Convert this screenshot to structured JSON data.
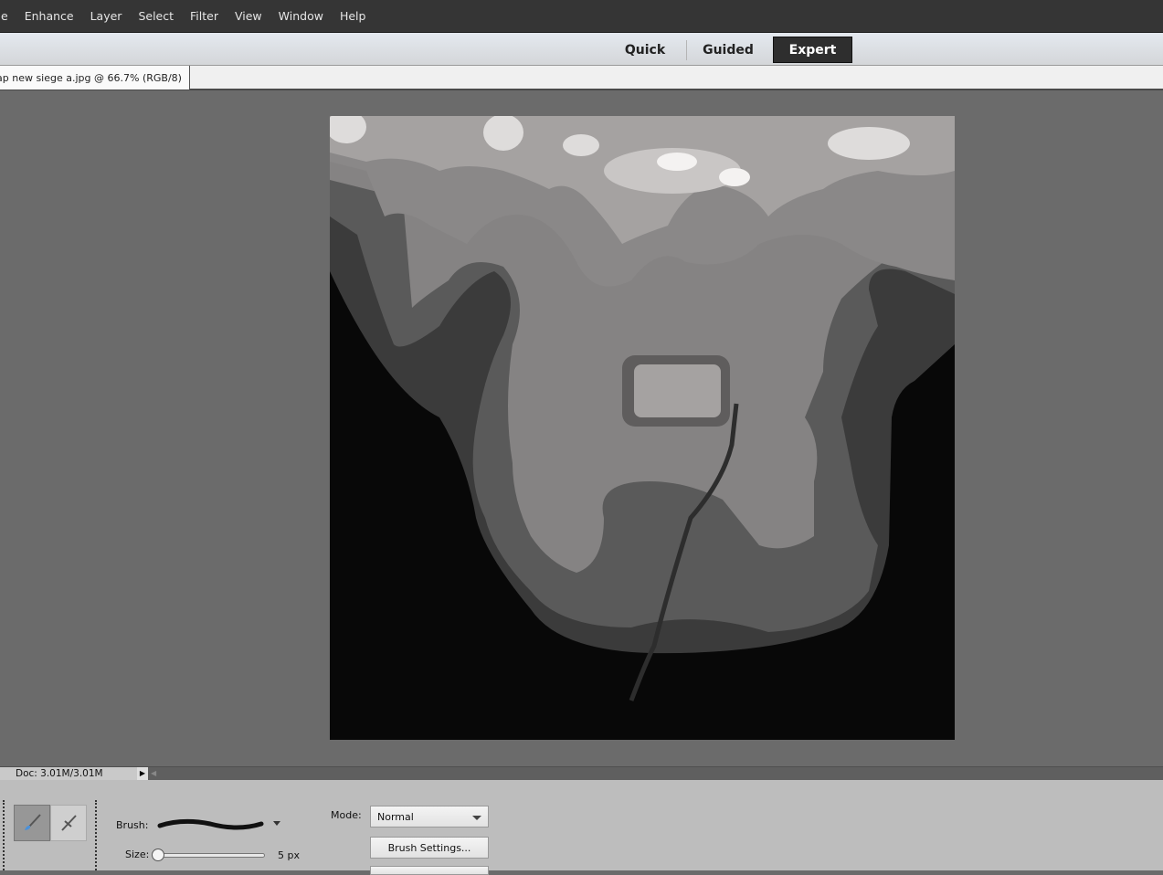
{
  "menubar": {
    "items": [
      "e",
      "Enhance",
      "Layer",
      "Select",
      "Filter",
      "View",
      "Window",
      "Help"
    ]
  },
  "modes": {
    "quick": "Quick",
    "guided": "Guided",
    "expert": "Expert",
    "active": "Expert"
  },
  "document_tab": {
    "title": "ap new siege a.jpg @ 66.7% (RGB/8)",
    "close": "×"
  },
  "status": {
    "doc_info": "Doc: 3.01M/3.01M",
    "arrow": "▶",
    "scroll_left": "◀"
  },
  "options": {
    "tools": [
      {
        "icon": "brush-icon",
        "active": true
      },
      {
        "icon": "impressionist-brush-icon",
        "active": false
      }
    ],
    "brush_label": "Brush:",
    "size_label": "Size:",
    "size_value": "5 px",
    "size_fraction": 0.0,
    "mode_label": "Mode:",
    "mode_value": "Normal",
    "brush_settings": "Brush Settings..."
  },
  "colors": {
    "menubar": "#353535",
    "workspace": "#6b6b6b",
    "options_panel": "#bdbdbd",
    "active_mode": "#2e2e2e"
  }
}
